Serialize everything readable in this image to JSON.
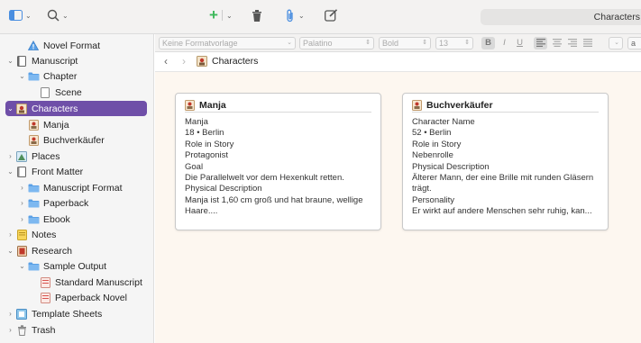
{
  "toolbar": {
    "window_title": "Characters"
  },
  "sidebar": {
    "items": [
      {
        "label": "Novel Format",
        "icon": "warning-icon",
        "disclosure": ""
      },
      {
        "label": "Manuscript",
        "icon": "manuscript-icon",
        "disclosure": "⌄"
      },
      {
        "label": "Chapter",
        "icon": "folder-icon",
        "disclosure": "⌄"
      },
      {
        "label": "Scene",
        "icon": "document-icon",
        "disclosure": ""
      },
      {
        "label": "Characters",
        "icon": "character-folder-icon",
        "disclosure": "⌄"
      },
      {
        "label": "Manja",
        "icon": "character-sheet-icon",
        "disclosure": ""
      },
      {
        "label": "Buchverkäufer",
        "icon": "character-sheet-icon",
        "disclosure": ""
      },
      {
        "label": "Places",
        "icon": "places-icon",
        "disclosure": "›"
      },
      {
        "label": "Front Matter",
        "icon": "front-matter-icon",
        "disclosure": "⌄"
      },
      {
        "label": "Manuscript Format",
        "icon": "folder-icon",
        "disclosure": "›"
      },
      {
        "label": "Paperback",
        "icon": "folder-icon",
        "disclosure": "›"
      },
      {
        "label": "Ebook",
        "icon": "folder-icon",
        "disclosure": "›"
      },
      {
        "label": "Notes",
        "icon": "notes-icon",
        "disclosure": "›"
      },
      {
        "label": "Research",
        "icon": "research-icon",
        "disclosure": "⌄"
      },
      {
        "label": "Sample Output",
        "icon": "folder-icon",
        "disclosure": "⌄"
      },
      {
        "label": "Standard Manuscript",
        "icon": "pdf-icon",
        "disclosure": ""
      },
      {
        "label": "Paperback Novel",
        "icon": "pdf-icon",
        "disclosure": ""
      },
      {
        "label": "Template Sheets",
        "icon": "template-icon",
        "disclosure": "›"
      },
      {
        "label": "Trash",
        "icon": "trash-icon",
        "disclosure": "›"
      }
    ],
    "selected": "Characters"
  },
  "format_bar": {
    "style": "Keine Formatvorlage",
    "font": "Palatino",
    "weight": "Bold",
    "size": "13",
    "bold": "B",
    "italic": "I",
    "underline": "U",
    "extra": "a"
  },
  "nav": {
    "breadcrumb": "Characters"
  },
  "cards": [
    {
      "title": "Manja",
      "lines": [
        "Manja",
        "18 • Berlin",
        "Role in Story",
        "Protagonist",
        "Goal",
        "Die Parallelwelt vor dem Hexenkult retten.",
        "Physical Description",
        "Manja ist 1,60 cm groß und hat braune, wellige Haare...."
      ]
    },
    {
      "title": "Buchverkäufer",
      "lines": [
        "Character Name",
        "52 • Berlin",
        "Role in Story",
        "Nebenrolle",
        "Physical Description",
        "Älterer Mann, der eine Brille mit runden Gläsern trägt.",
        "Personality",
        "Er wirkt auf andere Menschen sehr ruhig, kan..."
      ]
    }
  ],
  "colors": {
    "selection": "#6f4fa8",
    "folder": "#5aa0e6",
    "accent_green": "#3cb85a"
  }
}
